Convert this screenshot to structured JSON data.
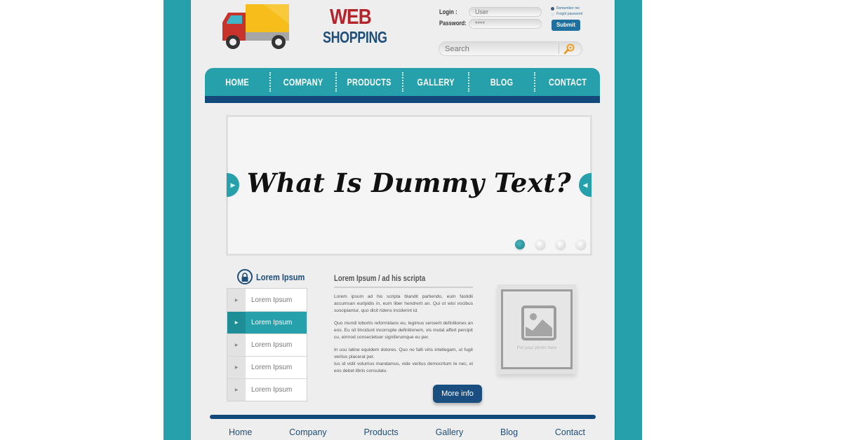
{
  "colors": {
    "teal": "#26a0aa",
    "navy": "#12487a",
    "logo_red": "#b5242a",
    "logo_blue": "#1f4e78",
    "page_bg": "#eeeeef"
  },
  "logo": {
    "line1": "WEB",
    "line2": "SHOPPING",
    "icon": "delivery-truck-icon"
  },
  "login": {
    "login_label": "Login :",
    "password_label": "Password:",
    "user_placeholder": "User",
    "password_placeholder": "****",
    "remember_label": "Remember me",
    "forgot_label": "Forgot password",
    "submit_label": "Submit"
  },
  "search": {
    "placeholder": "Search",
    "icon": "magnifier-icon"
  },
  "nav": {
    "items": [
      "HOME",
      "COMPANY",
      "PRODUCTS",
      "GALLERY",
      "BLOG",
      "CONTACT"
    ]
  },
  "slider": {
    "title": "What Is Dummy Text?",
    "prev_icon": "arrow-right-icon",
    "next_icon": "arrow-left-icon",
    "slide_count": 4,
    "active_slide": 1
  },
  "sidebar": {
    "heading": "Lorem Ipsum",
    "heading_icon": "lock-icon",
    "items": [
      {
        "label": "Lorem Ipsum",
        "active": false
      },
      {
        "label": "Lorem Ipsum",
        "active": true
      },
      {
        "label": "Lorem Ipsum",
        "active": false
      },
      {
        "label": "Lorem Ipsum",
        "active": false
      },
      {
        "label": "Lorem Ipsum",
        "active": false
      }
    ]
  },
  "article": {
    "title": "Lorem Ipsum / ad his scripta",
    "paragraphs": [
      "Lorem ipsum ad his scripta blandit partiendo, eum fastidii accumsan euripidis in, eum liber hendrerit an. Qui ut wisi vocibus suscipiantur, quo dicit ridens inciderint id.",
      "Quo mundi lobortis reformidans eu, legimus senserit definitiones an eos. Eu sit tincidunt incorrupte definitionem, vis mutat affert percipit cu, eirmod consectetuer signiferumque eu per.",
      "In usu latine equidem dolores. Quo no falli viris intellegam, ut fugit veritus placerat per.",
      "Ius id vidit volumus mandamus, vide veritus democritum te nec, ei eos debet libris consulatu."
    ],
    "more_button": "More info"
  },
  "photo": {
    "placeholder_text": "Put your photo here"
  },
  "footer": {
    "links": [
      "Home",
      "Company",
      "Products",
      "Gallery",
      "Blog",
      "Contact"
    ]
  }
}
